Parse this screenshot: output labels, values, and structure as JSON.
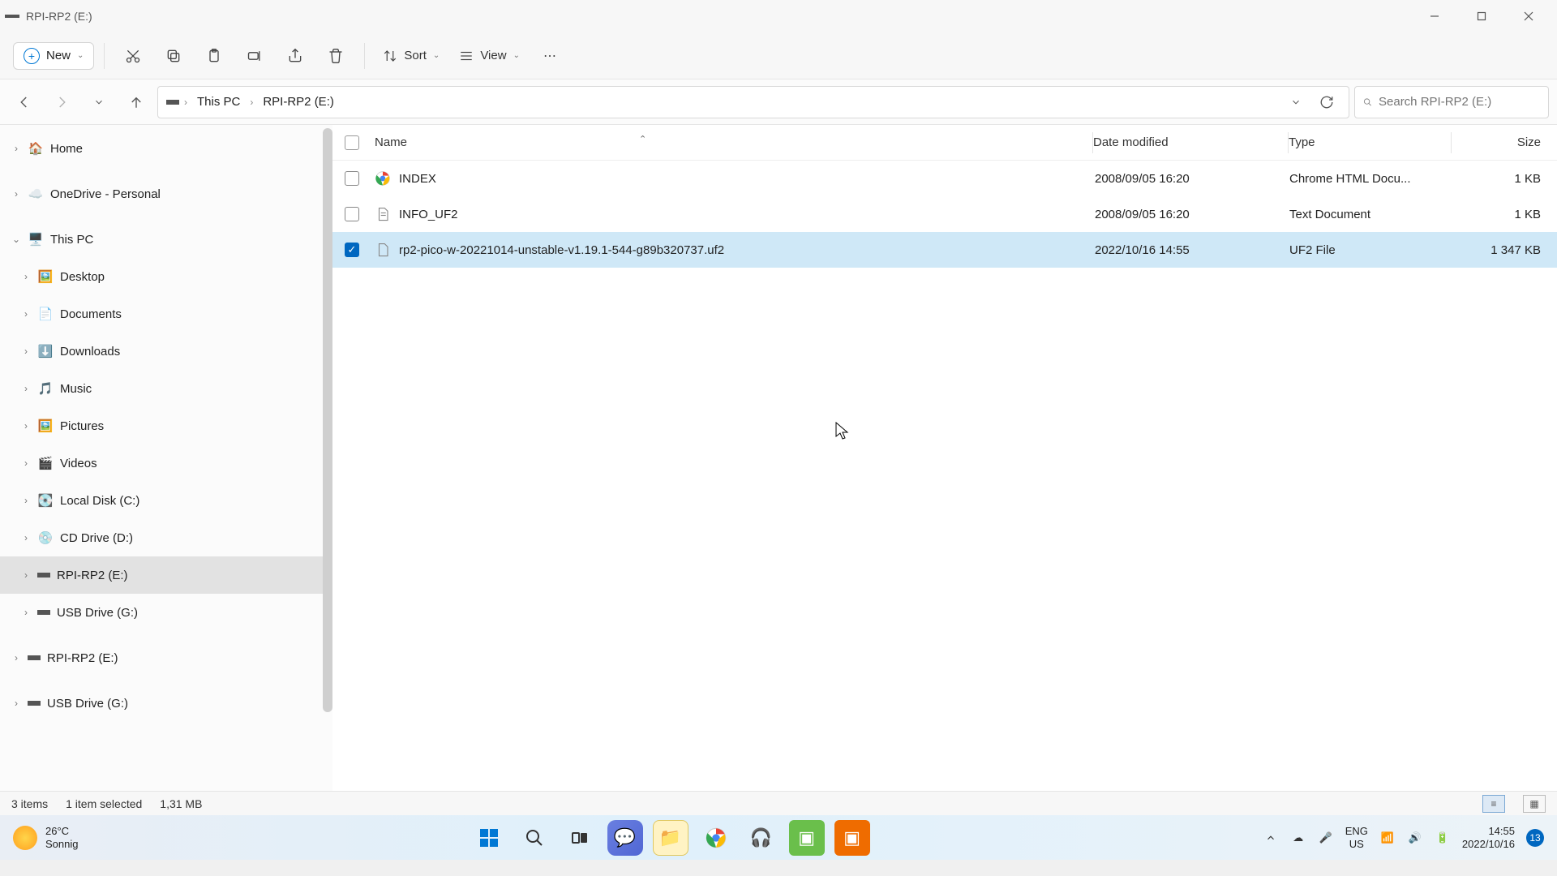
{
  "window": {
    "title": "RPI-RP2 (E:)"
  },
  "toolbar": {
    "new": "New",
    "sort": "Sort",
    "view": "View"
  },
  "breadcrumb": {
    "root": "This PC",
    "leaf": "RPI-RP2 (E:)"
  },
  "search": {
    "placeholder": "Search RPI-RP2 (E:)"
  },
  "nav": {
    "home": "Home",
    "onedrive": "OneDrive - Personal",
    "thispc": "This PC",
    "desktop": "Desktop",
    "documents": "Documents",
    "downloads": "Downloads",
    "music": "Music",
    "pictures": "Pictures",
    "videos": "Videos",
    "localc": "Local Disk (C:)",
    "cdd": "CD Drive (D:)",
    "rpie": "RPI-RP2 (E:)",
    "usbg": "USB Drive (G:)",
    "rpie2": "RPI-RP2 (E:)",
    "usbg2": "USB Drive (G:)"
  },
  "columns": {
    "name": "Name",
    "date": "Date modified",
    "type": "Type",
    "size": "Size"
  },
  "files": [
    {
      "name": "INDEX",
      "date": "2008/09/05 16:20",
      "type": "Chrome HTML Docu...",
      "size": "1 KB",
      "icon": "chrome",
      "selected": false
    },
    {
      "name": "INFO_UF2",
      "date": "2008/09/05 16:20",
      "type": "Text Document",
      "size": "1 KB",
      "icon": "text",
      "selected": false
    },
    {
      "name": "rp2-pico-w-20221014-unstable-v1.19.1-544-g89b320737.uf2",
      "date": "2022/10/16 14:55",
      "type": "UF2 File",
      "size": "1 347 KB",
      "icon": "generic",
      "selected": true
    }
  ],
  "status": {
    "count": "3 items",
    "selected": "1 item selected",
    "size": "1,31 MB"
  },
  "taskbar": {
    "temp": "26°C",
    "weather": "Sonnig",
    "lang1": "ENG",
    "lang2": "US",
    "time": "14:55",
    "date": "2022/10/16",
    "badge": "13"
  }
}
